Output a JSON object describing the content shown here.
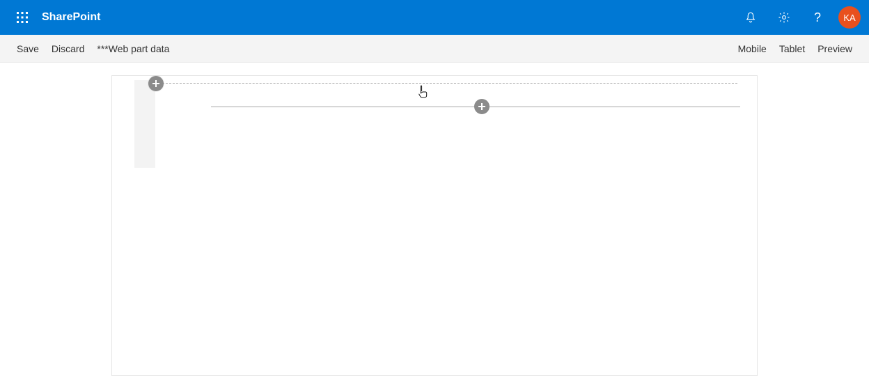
{
  "colors": {
    "brand": "#0078d4",
    "avatar": "#e8501e"
  },
  "suite": {
    "brand": "SharePoint",
    "avatar_initials": "KA"
  },
  "commandbar": {
    "left": {
      "save": "Save",
      "discard": "Discard",
      "webpart_data": "***Web part data"
    },
    "right": {
      "mobile": "Mobile",
      "tablet": "Tablet",
      "preview": "Preview"
    }
  }
}
